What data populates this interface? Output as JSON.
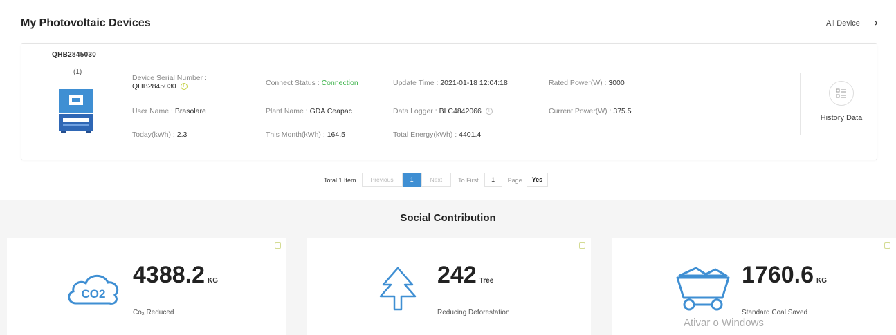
{
  "header": {
    "title": "My Photovoltaic Devices",
    "all_device_label": "All Device"
  },
  "device": {
    "id": "QHB2845030",
    "count": "(1)",
    "serial_label": "Device Serial Number :",
    "serial_value": "QHB2845030",
    "connect_label": "Connect Status :",
    "connect_value": "Connection",
    "update_label": "Update Time :",
    "update_value": "2021-01-18 12:04:18",
    "rated_label": "Rated Power(W) :",
    "rated_value": "3000",
    "user_label": "User Name :",
    "user_value": "Brasolare",
    "plant_label": "Plant Name :",
    "plant_value": "GDA Ceapac",
    "logger_label": "Data Logger :",
    "logger_value": "BLC4842066",
    "current_label": "Current Power(W) :",
    "current_value": "375.5",
    "today_label": "Today(kWh) :",
    "today_value": "2.3",
    "month_label": "This Month(kWh) :",
    "month_value": "164.5",
    "total_label": "Total Energy(kWh) :",
    "total_value": "4401.4",
    "history_label": "History Data"
  },
  "pagination": {
    "total": "Total 1 Item",
    "previous": "Previous",
    "current": "1",
    "next": "Next",
    "to_first": "To First",
    "page_input": "1",
    "page": "Page",
    "yes": "Yes"
  },
  "social": {
    "title": "Social Contribution",
    "co2": {
      "value": "4388.2",
      "unit": "KG",
      "label": "Co₂ Reduced",
      "icon_text": "CO2"
    },
    "tree": {
      "value": "242",
      "unit": "Tree",
      "label": "Reducing Deforestation"
    },
    "coal": {
      "value": "1760.6",
      "unit": "KG",
      "label": "Standard Coal Saved"
    }
  },
  "watermark": "Ativar o Windows",
  "colors": {
    "accent_blue": "#3f8fd3",
    "connection_green": "#3cb34a"
  }
}
